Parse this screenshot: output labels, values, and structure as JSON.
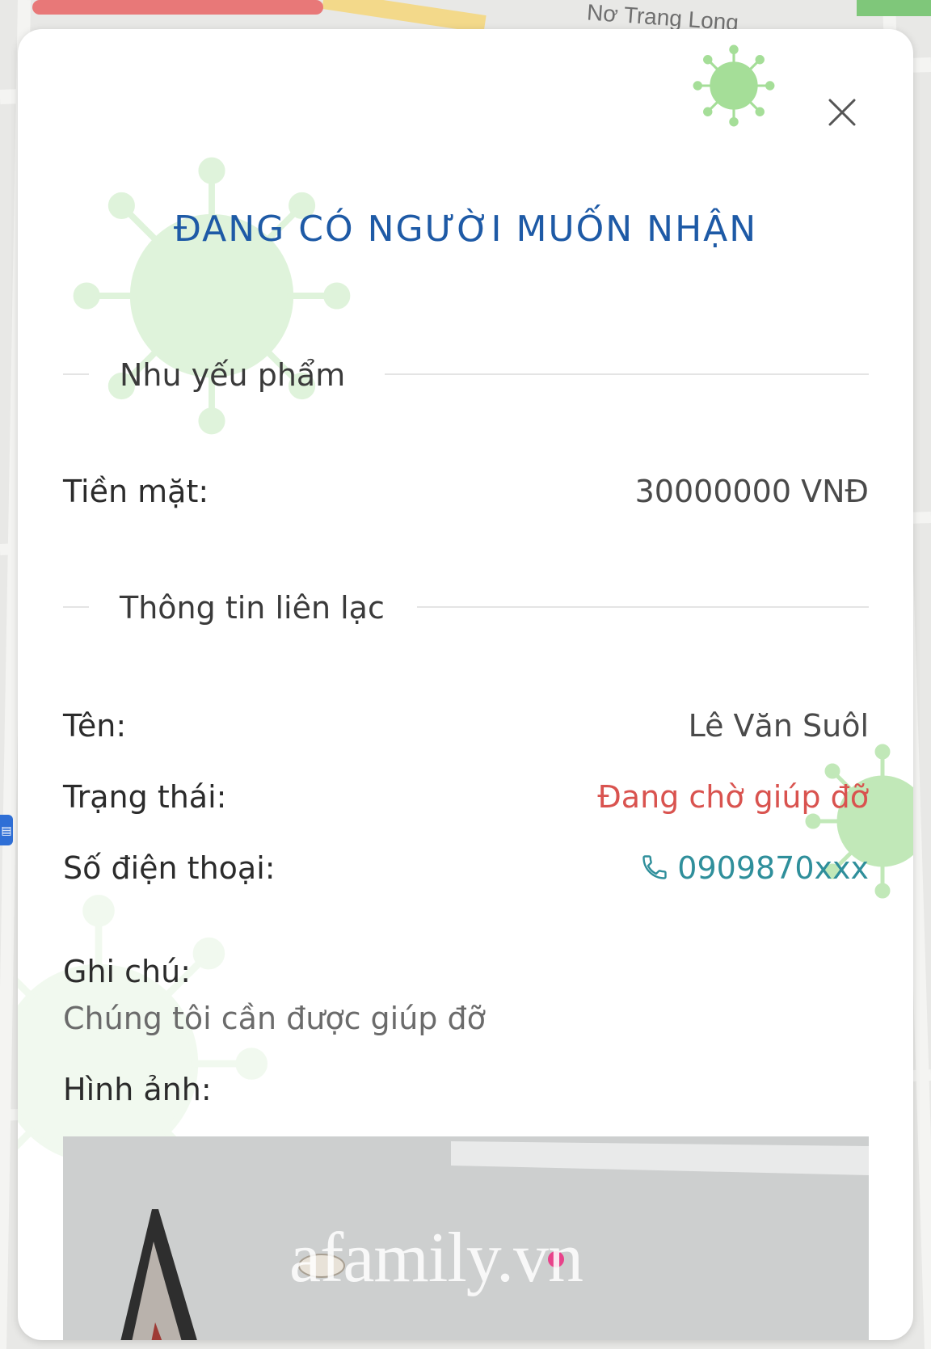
{
  "background_map": {
    "street_label": "Nơ Trang Long"
  },
  "modal": {
    "title": "ĐANG CÓ NGƯỜI MUỐN NHẬN",
    "sections": {
      "supplies": "Nhu yếu phẩm",
      "contact": "Thông tin liên lạc"
    },
    "cash": {
      "label": "Tiền mặt:",
      "value": "30000000 VNĐ"
    },
    "name": {
      "label": "Tên:",
      "value": "Lê Văn Suôl"
    },
    "status": {
      "label": "Trạng thái:",
      "value": "Đang chờ giúp đỡ",
      "color": "#d9534f"
    },
    "phone": {
      "label": "Số điện thoại:",
      "value": "0909870xxx",
      "icon": "phone-icon"
    },
    "note": {
      "label": "Ghi chú:",
      "value": "Chúng tôi cần được giúp đỡ"
    },
    "image": {
      "label": "Hình ảnh:",
      "watermark": "afamily.vn"
    },
    "close_icon": "close-icon",
    "colors": {
      "title": "#1e5aa6",
      "phone": "#2f8f9b",
      "virus": "#8fd67f"
    }
  }
}
